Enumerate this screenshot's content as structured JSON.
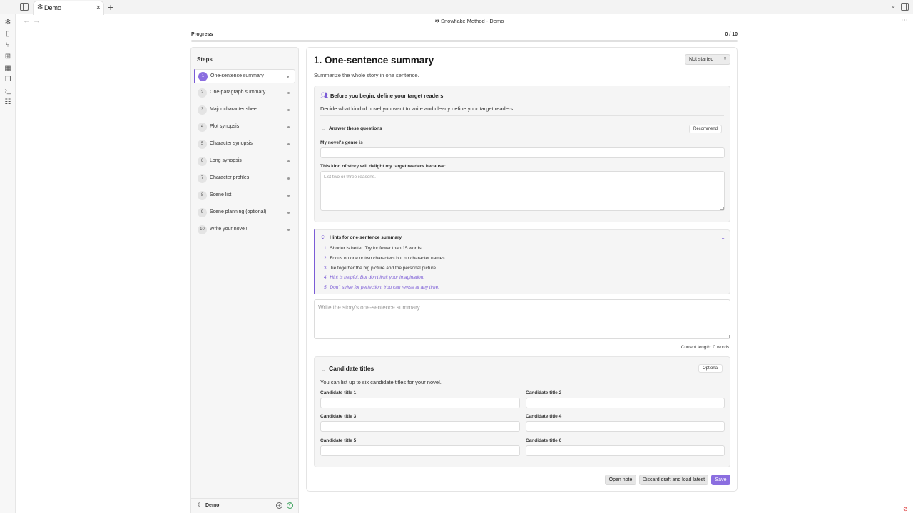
{
  "tab": {
    "title": "Demo"
  },
  "nav": {
    "title": "✻ Snowflake Method - Demo"
  },
  "progress": {
    "label": "Progress",
    "count": "0 / 10",
    "fraction": 0.0
  },
  "steps": {
    "title": "Steps",
    "items": [
      {
        "num": "1",
        "label": "One-sentence summary"
      },
      {
        "num": "2",
        "label": "One-paragraph summary"
      },
      {
        "num": "3",
        "label": "Major character sheet"
      },
      {
        "num": "4",
        "label": "Plot synopsis"
      },
      {
        "num": "5",
        "label": "Character synopsis"
      },
      {
        "num": "6",
        "label": "Long synopsis"
      },
      {
        "num": "7",
        "label": "Character profiles"
      },
      {
        "num": "8",
        "label": "Scene list"
      },
      {
        "num": "9",
        "label": "Scene planning (optional)"
      },
      {
        "num": "10",
        "label": "Write your novel!"
      }
    ],
    "workspace": "Demo"
  },
  "main": {
    "title": "1. One-sentence summary",
    "status": "Not started",
    "subtitle": "Summarize the whole story in one sentence.",
    "readers": {
      "heading": "Before you begin: define your target readers",
      "desc": "Decide what kind of novel you want to write and clearly define your target readers.",
      "questions_heading": "Answer these questions",
      "badge": "Recommend",
      "genre_label": "My novel's genre is",
      "genre_value": "",
      "delight_label": "This kind of story will delight my target readers because:",
      "delight_placeholder": "List two or three reasons."
    },
    "hints": {
      "heading": "Hints for one-sentence summary",
      "items": [
        {
          "n": "1.",
          "text": "Shorter is better. Try for fewer than 15 words."
        },
        {
          "n": "2.",
          "text": "Focus on one or two characters but no character names."
        },
        {
          "n": "3.",
          "text": "Tie together the big picture and the personal picture."
        },
        {
          "n": "4.",
          "text": "Hint is helpful. But don't limit your imagination."
        },
        {
          "n": "5.",
          "text": "Don't strive for perfection. You can revise at any time."
        }
      ]
    },
    "summary_placeholder": "Write the story's one-sentence summary.",
    "length_label": "Current length: 0 words.",
    "candidates": {
      "heading": "Candidate titles",
      "badge": "Optional",
      "desc": "You can list up to six candidate titles for your novel.",
      "labels": [
        "Candidate title 1",
        "Candidate title 2",
        "Candidate title 3",
        "Candidate title 4",
        "Candidate title 5",
        "Candidate title 6"
      ]
    },
    "buttons": {
      "open_note": "Open note",
      "discard": "Discard draft and load latest",
      "save": "Save"
    }
  },
  "colors": {
    "accent": "#7b5cd6",
    "accent_button": "#8b6ee0",
    "success": "#3aa15b"
  }
}
